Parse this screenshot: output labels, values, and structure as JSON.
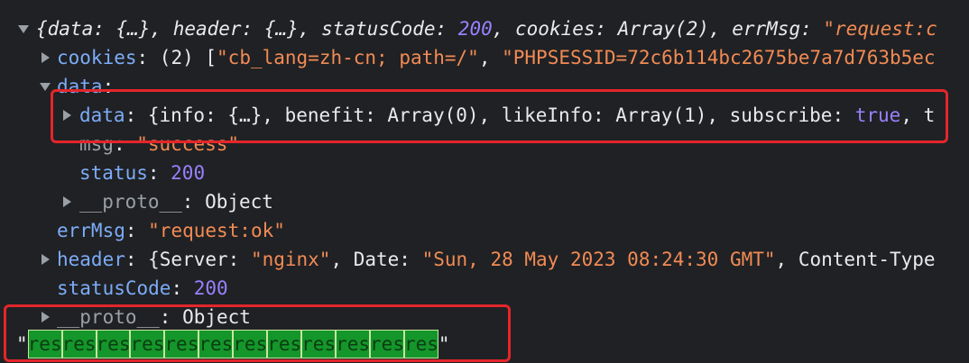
{
  "root": {
    "p1": "{data: {…}, header: {…}, statusCode: ",
    "status_val": "200",
    "p2": ", cookies: Array(2), errMsg: ",
    "errmsg_val": "\"request:c"
  },
  "cookies": {
    "key": "cookies",
    "mid": ": (2) [",
    "v1": "\"cb_lang=zh-cn; path=/\"",
    "sep": ", ",
    "v2": "\"PHPSESSID=72c6b114bc2675be7a7d763b5ec"
  },
  "data_key": {
    "key": "data",
    "colon": ":"
  },
  "inner_data": {
    "key": "data",
    "p1": ": {info: {…}, benefit: Array(0), likeInfo: Array(1), subscribe: ",
    "bool": "true",
    "p2": ", t"
  },
  "msg": {
    "key": "msg",
    "colon": ": ",
    "val": "\"success\""
  },
  "status": {
    "key": "status",
    "colon": ": ",
    "val": "200"
  },
  "proto_inner": {
    "key": "__proto__",
    "rest": ": Object"
  },
  "errmsg": {
    "key": "errMsg",
    "colon": ": ",
    "val": "\"request:ok\""
  },
  "header": {
    "key": "header",
    "p1": ": {Server: ",
    "server": "\"nginx\"",
    "p2": ", Date: ",
    "date": "\"Sun, 28 May 2023 08:24:30 GMT\"",
    "p3": ", Content-Type"
  },
  "status_code": {
    "key": "statusCode",
    "colon": ": ",
    "val": "200"
  },
  "proto_outer": {
    "key": "__proto__",
    "rest": ": Object"
  },
  "res_output": {
    "quote_open": "\"",
    "chips": [
      "res",
      "res",
      "res",
      "res",
      "res",
      "res",
      "res",
      "res",
      "res",
      "res",
      "res",
      "res"
    ],
    "quote_close": "\""
  },
  "colors": {
    "highlight_box": "#e4262b",
    "chip_bg": "#14962a",
    "background": "#202124"
  },
  "icons": [
    "expand-arrow-down-icon",
    "expand-arrow-right-icon"
  ]
}
